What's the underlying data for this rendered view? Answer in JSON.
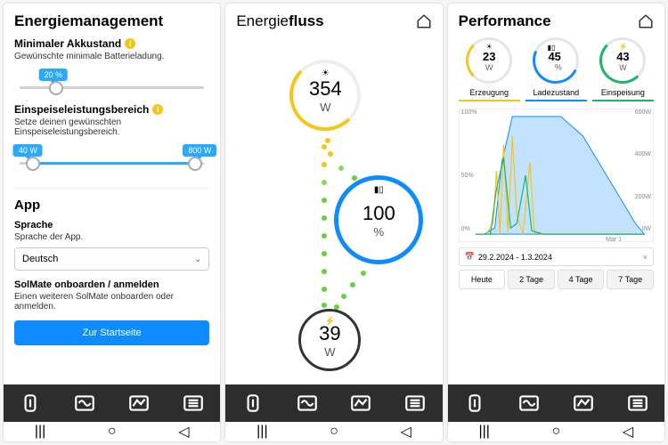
{
  "panel1": {
    "title": "Energiemanagement",
    "min_battery": {
      "label": "Minimaler Akkustand",
      "desc": "Gewünschte minimale Batterieladung.",
      "value_pct": 20,
      "badge": "20 %"
    },
    "feed_range": {
      "label": "Einspeiseleistungsbereich",
      "desc": "Setze deinen gewünschten Einspeiseleistungsbereich.",
      "low_badge": "40 W",
      "high_badge": "800 W",
      "low_pct": 7,
      "high_pct": 95
    },
    "app_section": "App",
    "language": {
      "label": "Sprache",
      "desc": "Sprache der App.",
      "selected": "Deutsch"
    },
    "onboard": {
      "label": "SolMate onboarden / anmelden",
      "desc": "Einen weiteren SolMate onboarden oder anmelden.",
      "button": "Zur Startseite"
    }
  },
  "panel2": {
    "title": "Energiefluss",
    "solar": {
      "value": "354",
      "unit": "W"
    },
    "battery": {
      "value": "100",
      "unit": "%"
    },
    "feed": {
      "value": "39",
      "unit": "W"
    }
  },
  "panel3": {
    "title": "Performance",
    "metrics": {
      "erzeugung": {
        "label": "Erzeugung",
        "value": "23",
        "unit": "W"
      },
      "ladezustand": {
        "label": "Ladezustand",
        "value": "45",
        "unit": "%"
      },
      "einspeisung": {
        "label": "Einspeisung",
        "value": "43",
        "unit": "W"
      }
    },
    "date_range": "29.2.2024 - 1.3.2024",
    "range_buttons": [
      "Heute",
      "2 Tage",
      "4 Tage",
      "7 Tage"
    ],
    "xaxis_label": "Mar 1",
    "y_left": [
      "100%",
      "50%",
      "0%"
    ],
    "y_right": [
      "600W",
      "400W",
      "200W",
      "0W"
    ]
  },
  "chart_data": {
    "type": "line",
    "title": "Performance",
    "x_range": "29.2.2024 – 1.3.2024",
    "series": [
      {
        "name": "Ladezustand",
        "unit": "%",
        "axis": "left",
        "approx_values": [
          5,
          5,
          5,
          5,
          10,
          65,
          100,
          100,
          100,
          100,
          95,
          80,
          68,
          55,
          42,
          30,
          15,
          5,
          5
        ]
      },
      {
        "name": "Erzeugung",
        "unit": "W",
        "axis": "right",
        "approx_values": [
          0,
          0,
          0,
          20,
          180,
          420,
          120,
          60,
          300,
          40,
          20,
          0,
          0,
          0,
          0,
          0,
          0,
          0,
          0
        ]
      },
      {
        "name": "Einspeisung",
        "unit": "W",
        "axis": "right",
        "approx_values": [
          0,
          0,
          0,
          10,
          140,
          380,
          100,
          40,
          260,
          30,
          10,
          0,
          0,
          0,
          0,
          0,
          0,
          0,
          0
        ]
      }
    ],
    "y_left": {
      "min": 0,
      "max": 100,
      "label": "%"
    },
    "y_right": {
      "min": 0,
      "max": 600,
      "label": "W"
    }
  }
}
